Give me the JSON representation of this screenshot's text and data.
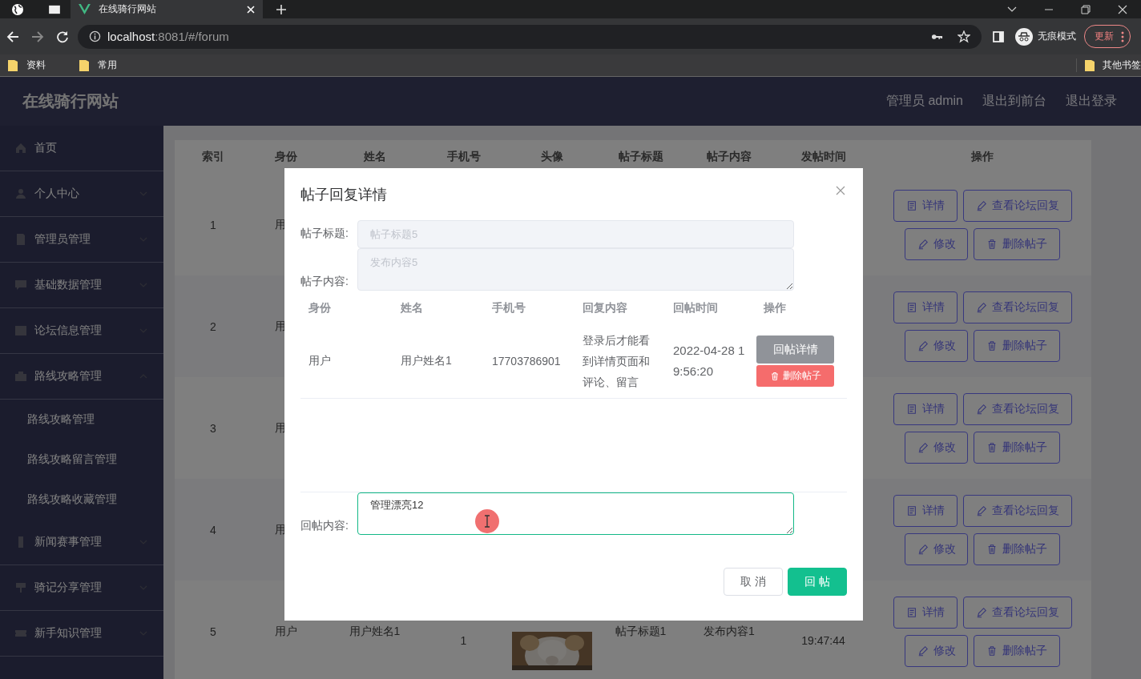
{
  "browser": {
    "tab": {
      "title": "在线骑行网站"
    },
    "address": {
      "host": "localhost",
      "path": ":8081/#/forum"
    },
    "profile": {
      "label": "无痕模式"
    },
    "update_button": {
      "label": "更新"
    },
    "bookmarks": [
      {
        "label": "资料"
      },
      {
        "label": "常用"
      }
    ],
    "other_bookmarks": {
      "label": "其他书签"
    }
  },
  "app": {
    "title": "在线骑行网站",
    "user": "管理员 admin",
    "links": [
      "退出到前台",
      "退出登录"
    ]
  },
  "sidebar": {
    "items": [
      {
        "label": "首页",
        "kind": "link"
      },
      {
        "label": "个人中心",
        "kind": "group",
        "expanded": false
      },
      {
        "label": "管理员管理",
        "kind": "group",
        "expanded": false
      },
      {
        "label": "基础数据管理",
        "kind": "group",
        "expanded": false
      },
      {
        "label": "论坛信息管理",
        "kind": "group",
        "expanded": false
      },
      {
        "label": "路线攻略管理",
        "kind": "group",
        "expanded": true,
        "children": [
          {
            "label": "路线攻略管理"
          },
          {
            "label": "路线攻略留言管理"
          },
          {
            "label": "路线攻略收藏管理"
          }
        ]
      },
      {
        "label": "新闻赛事管理",
        "kind": "group",
        "expanded": false
      },
      {
        "label": "骑记分享管理",
        "kind": "group",
        "expanded": false
      },
      {
        "label": "新手知识管理",
        "kind": "group",
        "expanded": false
      }
    ]
  },
  "table": {
    "columns": [
      "索引",
      "身份",
      "姓名",
      "手机号",
      "头像",
      "帖子标题",
      "帖子内容",
      "发帖时间",
      "操作"
    ],
    "rows": [
      {
        "index": "1",
        "identity": "用",
        "actions": [
          {
            "label": "详情",
            "kind": "detail"
          },
          {
            "label": "查看论坛回复",
            "kind": "replies"
          },
          {
            "label": "修改",
            "kind": "edit"
          },
          {
            "label": "删除帖子",
            "kind": "delete"
          }
        ]
      },
      {
        "index": "2",
        "identity": "用",
        "actions": [
          {
            "label": "详情",
            "kind": "detail"
          },
          {
            "label": "查看论坛回复",
            "kind": "replies"
          },
          {
            "label": "修改",
            "kind": "edit"
          },
          {
            "label": "删除帖子",
            "kind": "delete"
          }
        ]
      },
      {
        "index": "3",
        "identity": "用",
        "actions": [
          {
            "label": "详情",
            "kind": "detail"
          },
          {
            "label": "查看论坛回复",
            "kind": "replies"
          },
          {
            "label": "修改",
            "kind": "edit"
          },
          {
            "label": "删除帖子",
            "kind": "delete"
          }
        ]
      },
      {
        "index": "4",
        "identity": "用",
        "actions": [
          {
            "label": "详情",
            "kind": "detail"
          },
          {
            "label": "查看论坛回复",
            "kind": "replies"
          },
          {
            "label": "修改",
            "kind": "edit"
          },
          {
            "label": "删除帖子",
            "kind": "delete"
          }
        ]
      },
      {
        "index": "5",
        "identity": "用户",
        "name": "用户姓名1",
        "phone": "1",
        "avatar": {
          "kind": "picture"
        },
        "post_title": "帖子标题1",
        "post_content": "发布内容1",
        "post_time": "19:47:44",
        "actions": [
          {
            "label": "详情",
            "kind": "detail"
          },
          {
            "label": "查看论坛回复",
            "kind": "replies"
          },
          {
            "label": "修改",
            "kind": "edit"
          },
          {
            "label": "删除帖子",
            "kind": "delete"
          }
        ]
      }
    ]
  },
  "dialog": {
    "title": "帖子回复详情",
    "fields": [
      {
        "label": "帖子标题:",
        "value": "帖子标题5",
        "kind": "input",
        "disabled": true
      },
      {
        "label": "帖子内容:",
        "value": "发布内容5",
        "kind": "textarea",
        "disabled": true
      }
    ],
    "replies": {
      "columns": [
        "身份",
        "姓名",
        "手机号",
        "回复内容",
        "回帖时间",
        "操作"
      ],
      "rows": [
        {
          "identity": "用户",
          "name": "用户姓名1",
          "phone": "17703786901",
          "content": "登录后才能看到详情页面和评论、留言",
          "time": "2022-04-28 19:56:20",
          "actions": [
            {
              "label": "回帖详情",
              "kind": "detail"
            },
            {
              "label": "删除帖子",
              "kind": "delete"
            }
          ]
        }
      ]
    },
    "reply_field": {
      "label": "回帖内容:",
      "value": "管理漂亮12"
    },
    "buttons": [
      {
        "label": "取 消",
        "kind": "cancel"
      },
      {
        "label": "回 帖",
        "kind": "primary"
      }
    ]
  }
}
